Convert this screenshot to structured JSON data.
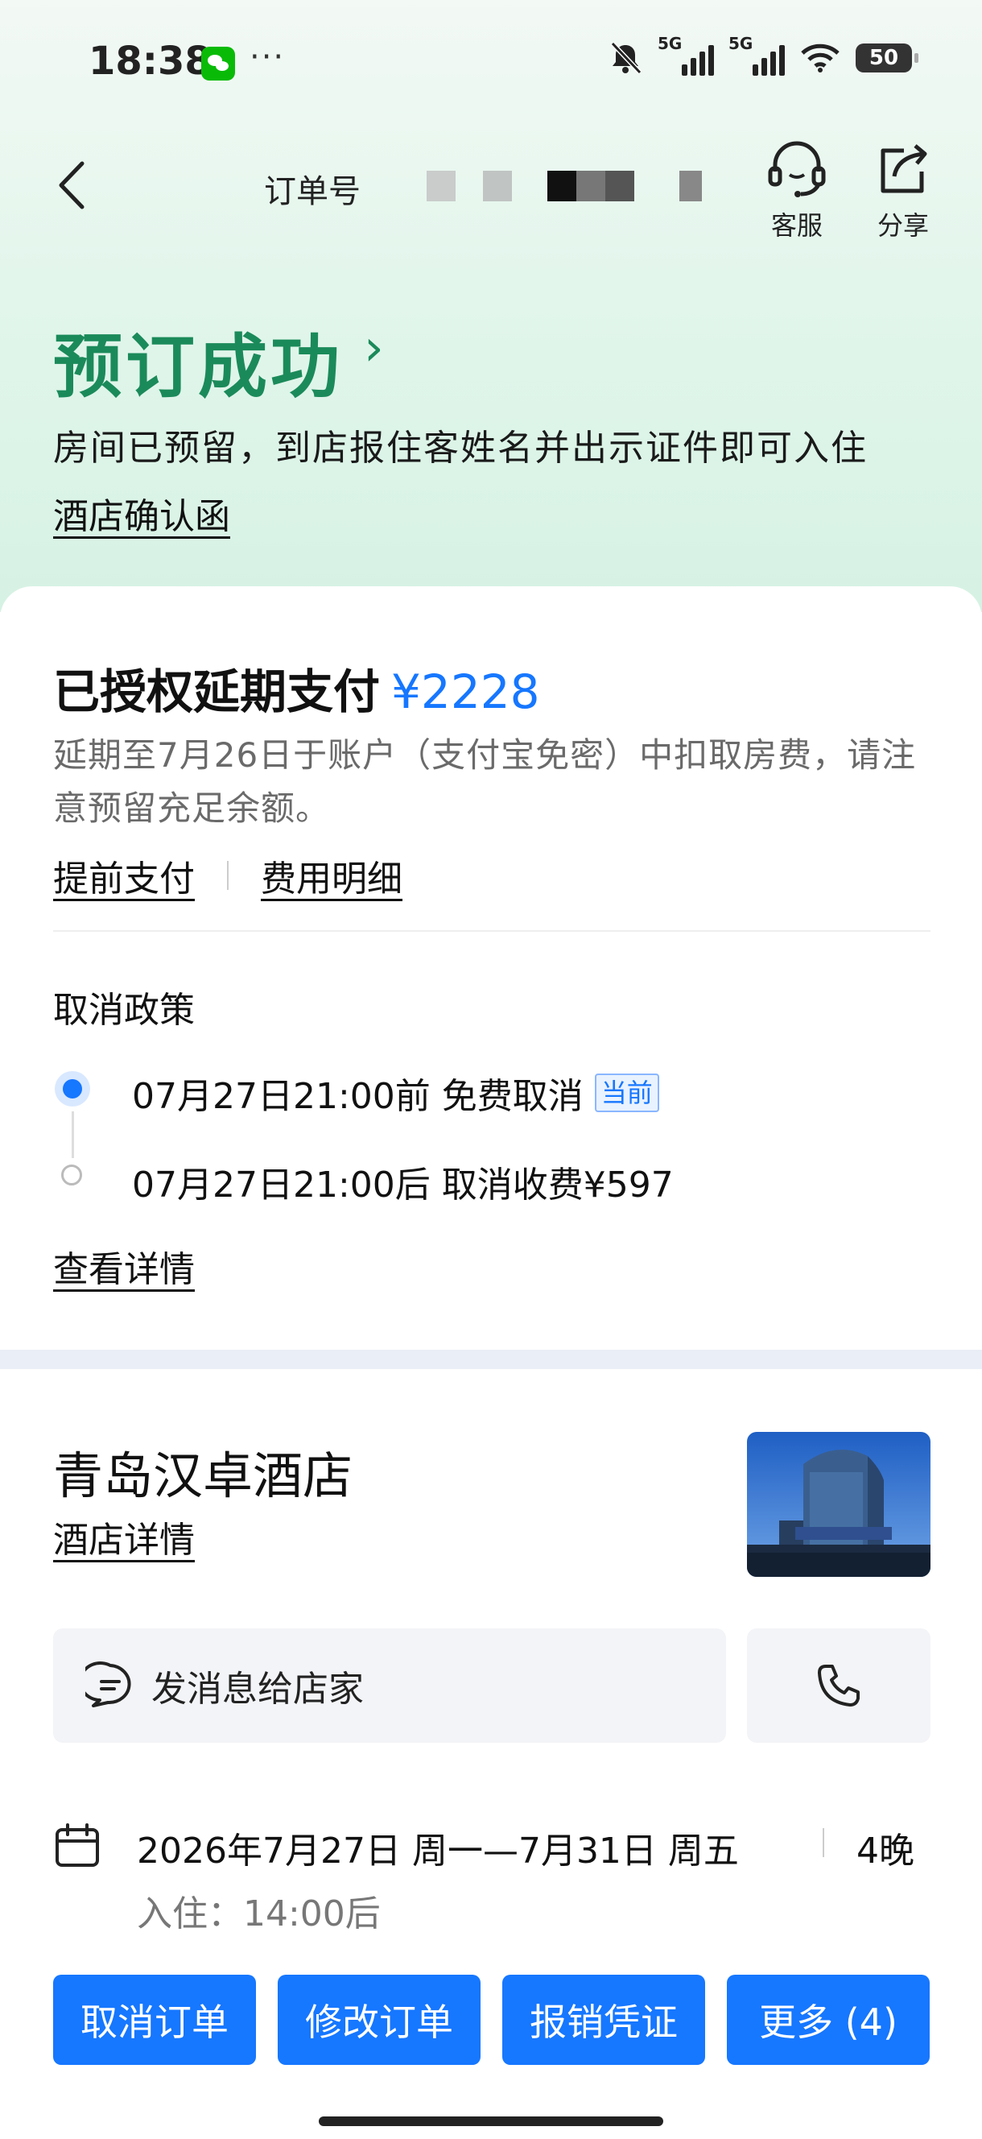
{
  "status_bar": {
    "time": "18:38",
    "dots": "···",
    "sim1": "5G",
    "sim2": "5G",
    "battery": "50"
  },
  "nav": {
    "order_label": "订单号",
    "service_label": "客服",
    "share_label": "分享"
  },
  "success": {
    "title": "预订成功",
    "chevron": "›",
    "desc": "房间已预留，到店报住客姓名并出示证件即可入住",
    "confirm_link": "酒店确认函"
  },
  "payment": {
    "title": "已授权延期支付",
    "amount": "¥2228",
    "desc": "延期至7月26日于账户（支付宝免密）中扣取房费，请注意预留充足余额。",
    "prepay_link": "提前支付",
    "fee_link": "费用明细"
  },
  "policy": {
    "title": "取消政策",
    "item1": "07月27日21:00前 免费取消",
    "item1_badge": "当前",
    "item2": "07月27日21:00后 取消收费¥597",
    "detail_link": "查看详情"
  },
  "hotel": {
    "name": "青岛汉卓酒店",
    "detail_link": "酒店详情",
    "message_btn": "发消息给店家",
    "dates": "2026年7月27日 周一—7月31日 周五",
    "nights": "4晚",
    "checkin": "入住：14:00后"
  },
  "actions": [
    "取消订单",
    "修改订单",
    "报销凭证",
    "更多 (4)"
  ],
  "colors": {
    "accent": "#1677ff",
    "success": "#1b8a5a"
  }
}
